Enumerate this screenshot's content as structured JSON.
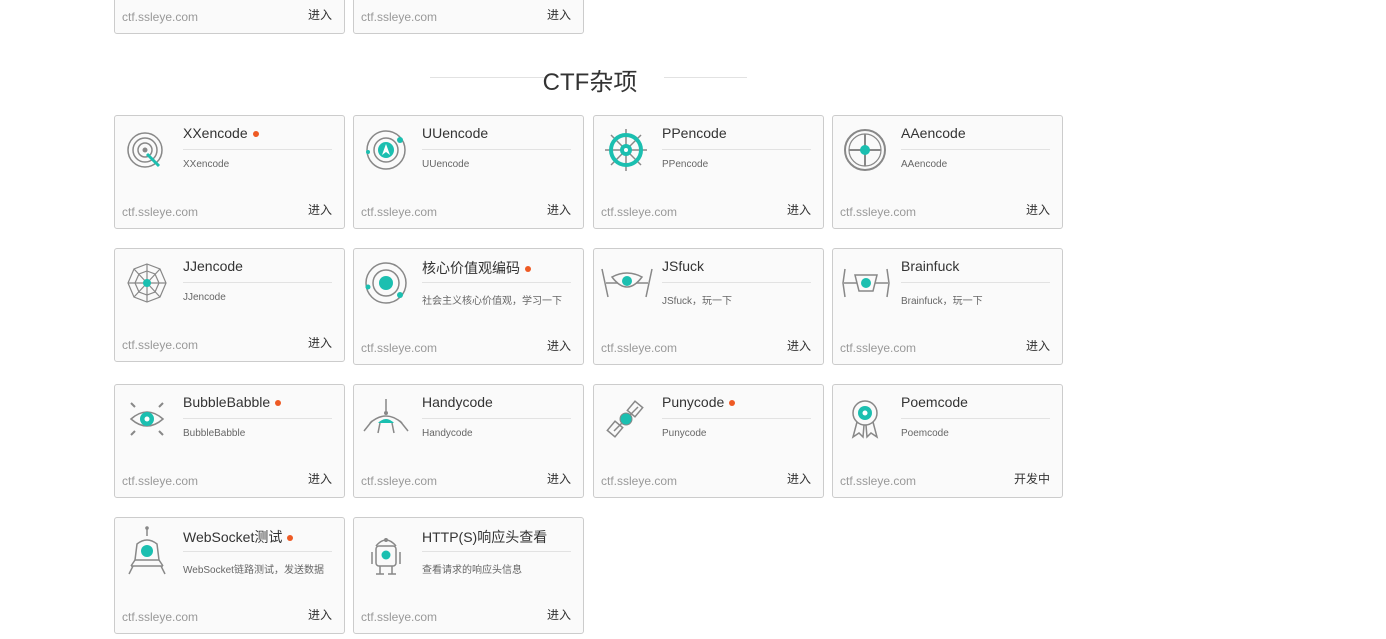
{
  "top_cards": [
    {
      "url": "ctf.ssleye.com",
      "action": "进入"
    },
    {
      "url": "ctf.ssleye.com",
      "action": "进入"
    }
  ],
  "section": {
    "title": "CTF杂项"
  },
  "cards": [
    {
      "title": "XXencode",
      "badge": true,
      "desc": "XXencode",
      "url": "ctf.ssleye.com",
      "action": "进入",
      "icon": "target-icon"
    },
    {
      "title": "UUencode",
      "badge": false,
      "desc": "UUencode",
      "url": "ctf.ssleye.com",
      "action": "进入",
      "icon": "orbit-compass-icon"
    },
    {
      "title": "PPencode",
      "badge": false,
      "desc": "PPencode",
      "url": "ctf.ssleye.com",
      "action": "进入",
      "icon": "ship-wheel-icon"
    },
    {
      "title": "AAencode",
      "badge": false,
      "desc": "AAencode",
      "url": "ctf.ssleye.com",
      "action": "进入",
      "icon": "steering-wheel-icon"
    },
    {
      "title": "JJencode",
      "badge": false,
      "desc": "JJencode",
      "url": "ctf.ssleye.com",
      "action": "进入",
      "icon": "spider-web-icon"
    },
    {
      "title": "核心价值观编码",
      "badge": true,
      "desc": "社会主义核心价值观，学习一下",
      "url": "ctf.ssleye.com",
      "action": "进入",
      "icon": "planet-orbit-icon"
    },
    {
      "title": "JSfuck",
      "badge": false,
      "desc": "JSfuck，玩一下",
      "url": "ctf.ssleye.com",
      "action": "进入",
      "icon": "tie-fighter-icon"
    },
    {
      "title": "Brainfuck",
      "badge": false,
      "desc": "Brainfuck，玩一下",
      "url": "ctf.ssleye.com",
      "action": "进入",
      "icon": "tie-fighter-alt-icon"
    },
    {
      "title": "BubbleBabble",
      "badge": true,
      "desc": "BubbleBabble",
      "url": "ctf.ssleye.com",
      "action": "进入",
      "icon": "eye-icon"
    },
    {
      "title": "Handycode",
      "badge": false,
      "desc": "Handycode",
      "url": "ctf.ssleye.com",
      "action": "进入",
      "icon": "lander-icon"
    },
    {
      "title": "Punycode",
      "badge": true,
      "desc": "Punycode",
      "url": "ctf.ssleye.com",
      "action": "进入",
      "icon": "satellite-icon"
    },
    {
      "title": "Poemcode",
      "badge": false,
      "desc": "Poemcode",
      "url": "ctf.ssleye.com",
      "action": "开发中",
      "icon": "medal-icon"
    },
    {
      "title": "WebSocket测试",
      "badge": true,
      "desc": "WebSocket链路测试，发送数据",
      "url": "ctf.ssleye.com",
      "action": "进入",
      "icon": "rocket-pod-icon"
    },
    {
      "title": "HTTP(S)响应头查看",
      "badge": false,
      "desc": "查看请求的响应头信息",
      "url": "ctf.ssleye.com",
      "action": "进入",
      "icon": "robot-icon"
    }
  ],
  "colors": {
    "accent": "#1bbfb0",
    "badge": "#ee5a24",
    "icon_stroke": "#888888"
  }
}
